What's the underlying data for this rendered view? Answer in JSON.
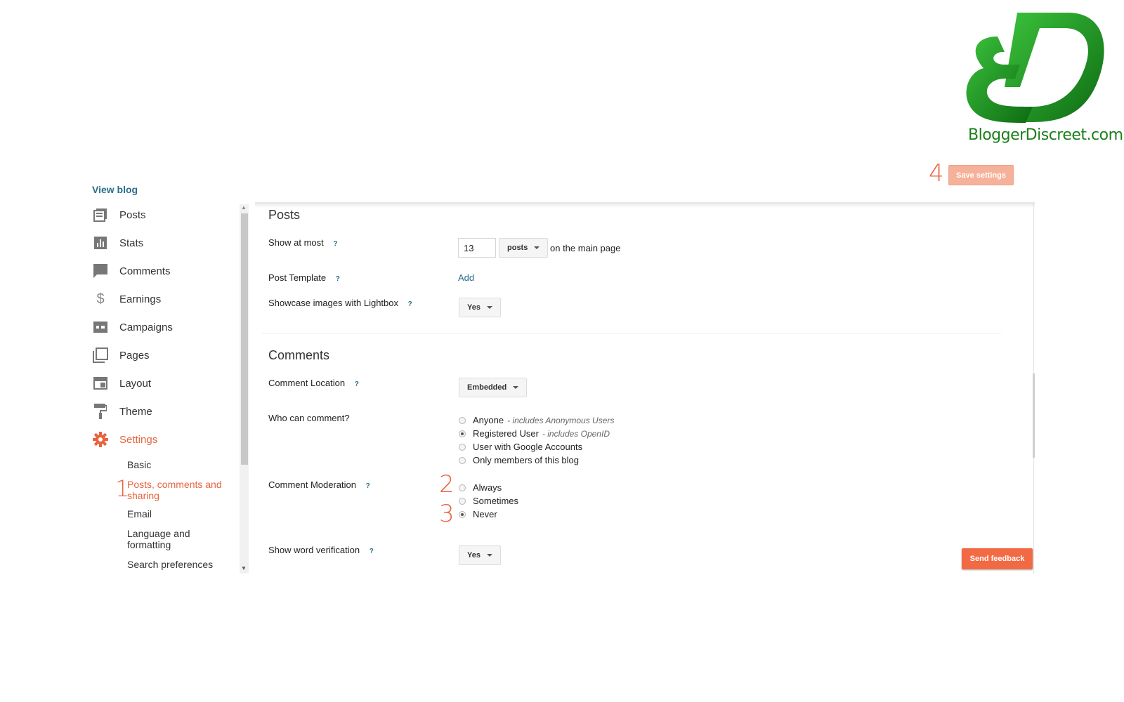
{
  "logo": {
    "text": "BloggerDiscreet.com",
    "brand_color": "#1b8a1b"
  },
  "header": {
    "view_blog": "View blog",
    "save_settings": "Save settings"
  },
  "markers": {
    "m1": "1",
    "m2": "2",
    "m3": "3",
    "m4": "4"
  },
  "sidebar": {
    "items": [
      {
        "label": "Posts",
        "icon": "posts-icon"
      },
      {
        "label": "Stats",
        "icon": "stats-icon"
      },
      {
        "label": "Comments",
        "icon": "comments-icon"
      },
      {
        "label": "Earnings",
        "icon": "dollar-icon"
      },
      {
        "label": "Campaigns",
        "icon": "campaigns-icon"
      },
      {
        "label": "Pages",
        "icon": "pages-icon"
      },
      {
        "label": "Layout",
        "icon": "layout-icon"
      },
      {
        "label": "Theme",
        "icon": "theme-roller-icon"
      },
      {
        "label": "Settings",
        "icon": "gear-icon",
        "active": true
      }
    ],
    "sub_items": [
      {
        "label": "Basic"
      },
      {
        "label": "Posts, comments and sharing",
        "active": true
      },
      {
        "label": "Email"
      },
      {
        "label": "Language and formatting"
      },
      {
        "label": "Search preferences"
      }
    ]
  },
  "posts_section": {
    "title": "Posts",
    "show_at_most": {
      "label": "Show at most",
      "help": "?",
      "value": "13",
      "unit": "posts",
      "suffix": "on the main page"
    },
    "post_template": {
      "label": "Post Template",
      "help": "?",
      "action": "Add"
    },
    "lightbox": {
      "label": "Showcase images with Lightbox",
      "help": "?",
      "value": "Yes"
    }
  },
  "comments_section": {
    "title": "Comments",
    "location": {
      "label": "Comment Location",
      "help": "?",
      "value": "Embedded"
    },
    "who_can_comment": {
      "label": "Who can comment?",
      "options": [
        {
          "label": "Anyone",
          "note": "- includes Anonymous Users",
          "checked": false
        },
        {
          "label": "Registered User",
          "note": "- includes OpenID",
          "checked": true
        },
        {
          "label": "User with Google Accounts",
          "note": "",
          "checked": false
        },
        {
          "label": "Only members of this blog",
          "note": "",
          "checked": false
        }
      ]
    },
    "moderation": {
      "label": "Comment Moderation",
      "help": "?",
      "options": [
        {
          "label": "Always",
          "checked": false
        },
        {
          "label": "Sometimes",
          "checked": false
        },
        {
          "label": "Never",
          "checked": true
        }
      ]
    },
    "word_verification": {
      "label": "Show word verification",
      "help": "?",
      "value": "Yes"
    }
  },
  "feedback": {
    "label": "Send feedback"
  },
  "colors": {
    "accent": "#e8643f",
    "link": "#2a6f8a",
    "save_disabled": "#f5b199"
  }
}
